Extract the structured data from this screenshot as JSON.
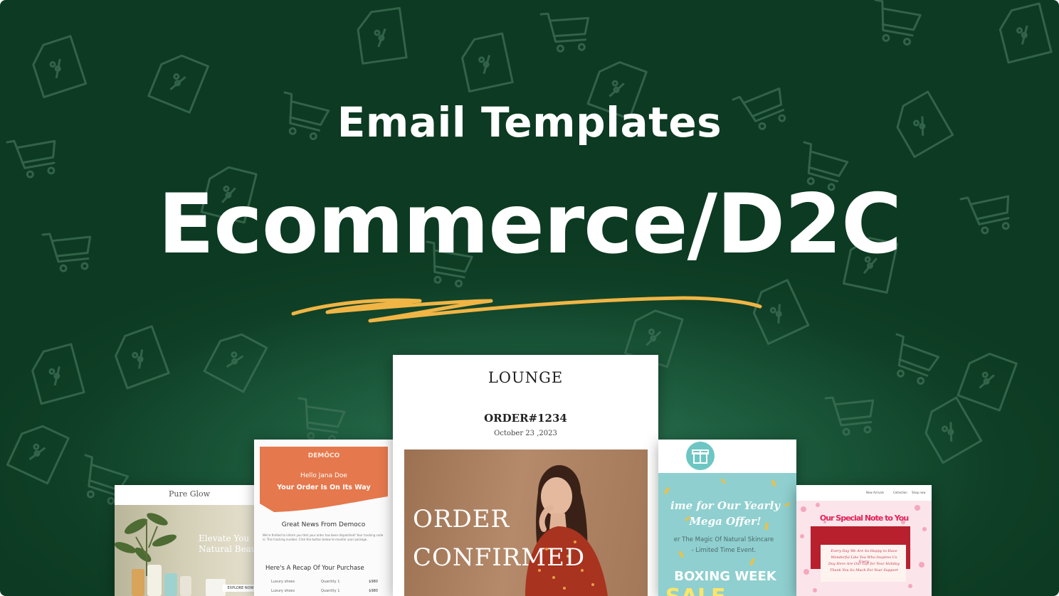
{
  "banner": {
    "subtitle": "Email Templates",
    "title": "Ecommerce/D2C",
    "colors": {
      "background": "#0f3f26",
      "accent": "#f0b545",
      "text": "#ffffff"
    }
  },
  "cards": {
    "pure_glow": {
      "brand": "Pure Glow",
      "headline_line1": "Elevate You",
      "headline_line2": "Natural Beaut",
      "button": "EXPLORE NOW"
    },
    "democo": {
      "brand": "DEMŌCO",
      "hello": "Hello Jana Doe",
      "status": "Your Order Is On Its Way",
      "news": "Great News From Democo",
      "body": "We're thrilled to inform you that your order has been dispatched! Your tracking code is: This tracking number. Click the button below to monitor your package.",
      "recap": "Here's A Recap Of Your Purchase",
      "items": [
        {
          "name": "Luxury shoes",
          "qty": "Quantity 1",
          "price": "$980"
        },
        {
          "name": "Luxury shoes",
          "qty": "Quantity 1",
          "price": "$980"
        }
      ]
    },
    "lounge": {
      "brand": "LOUNGE",
      "order": "ORDER#1234",
      "date": "October 23 ,2023",
      "headline_line1": "ORDER",
      "headline_line2": "CONFIRMED"
    },
    "mega": {
      "headline_line1": "ime for Our Yearly",
      "headline_line2": "Mega Offer!",
      "sub_line1": "er The Magic Of Natural Skincare",
      "sub_line2": "- Limited Time Event.",
      "boxing": "BOXING WEEK",
      "sale": "SALE"
    },
    "note": {
      "nav": [
        "New Arrivals",
        "Collection",
        "Shop now"
      ],
      "title": "Our Special Note to You",
      "script": [
        "Every Day We Are So Happy to Have",
        "Wonderful Like You Who Inspires Us Every",
        "Day Here Are Our Gift for Your Holiday",
        "Thank You So Much For Your Support"
      ]
    }
  }
}
